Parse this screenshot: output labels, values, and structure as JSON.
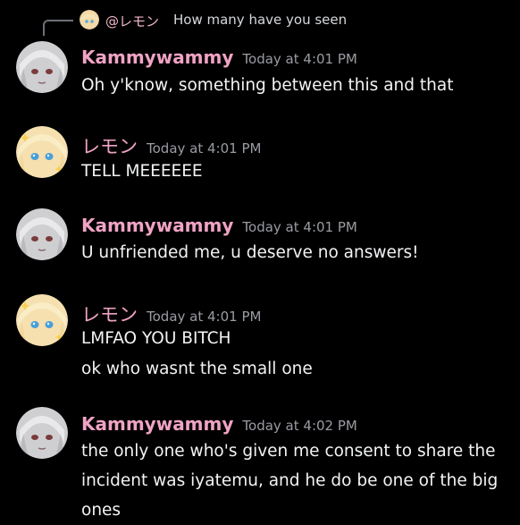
{
  "reply": {
    "author": "@レモン",
    "text": "How many have you seen"
  },
  "messages": [
    {
      "author": "Kammywammy",
      "time": "Today at 4:01 PM",
      "lines": [
        "Oh y'know, something between this and that"
      ],
      "avatar": "gray-hair-anime-avatar"
    },
    {
      "author": "レモン",
      "time": "Today at 4:01 PM",
      "lines": [
        "TELL MEEEEEE"
      ],
      "avatar": "blonde-anime-avatar"
    },
    {
      "author": "Kammywammy",
      "time": "Today at 4:01 PM",
      "lines": [
        "U unfriended me, u deserve no answers!"
      ],
      "avatar": "gray-hair-anime-avatar"
    },
    {
      "author": "レモン",
      "time": "Today at 4:01 PM",
      "lines": [
        "LMFAO YOU BITCH",
        "ok who wasnt the small one"
      ],
      "avatar": "blonde-anime-avatar"
    },
    {
      "author": "Kammywammy",
      "time": "Today at 4:02 PM",
      "lines": [
        "the only one who's given me consent to share the incident was iyatemu, and he do be one of the big ones"
      ],
      "avatar": "gray-hair-anime-avatar"
    }
  ],
  "colors": {
    "background": "#000000",
    "author": "#f0a3c4",
    "timestamp": "#9a9ca3",
    "text": "#f2f3f5",
    "reply_spine": "#6d6f78"
  }
}
